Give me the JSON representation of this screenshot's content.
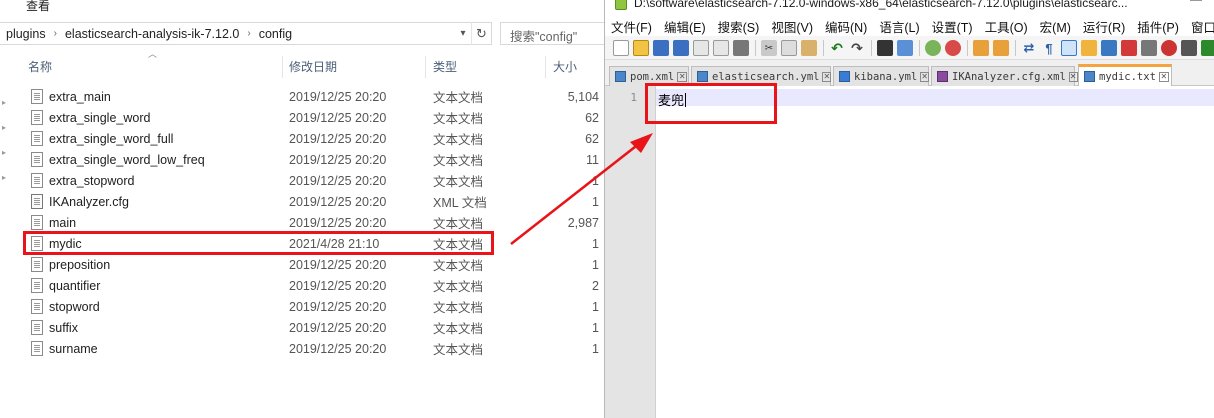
{
  "explorer": {
    "ribbon_tab": "查看",
    "address": {
      "segments": [
        "plugins",
        "elasticsearch-analysis-ik-7.12.0",
        "config"
      ],
      "dropdown_icon": "chevron-down-icon",
      "refresh_icon": "refresh-icon"
    },
    "search": {
      "placeholder": "搜索\"config\""
    },
    "columns": {
      "name": "名称",
      "date": "修改日期",
      "type": "类型",
      "size": "大小"
    },
    "files": [
      {
        "name": "extra_main",
        "date": "2019/12/25 20:20",
        "type": "文本文档",
        "size": "5,104"
      },
      {
        "name": "extra_single_word",
        "date": "2019/12/25 20:20",
        "type": "文本文档",
        "size": "62"
      },
      {
        "name": "extra_single_word_full",
        "date": "2019/12/25 20:20",
        "type": "文本文档",
        "size": "62"
      },
      {
        "name": "extra_single_word_low_freq",
        "date": "2019/12/25 20:20",
        "type": "文本文档",
        "size": "11"
      },
      {
        "name": "extra_stopword",
        "date": "2019/12/25 20:20",
        "type": "文本文档",
        "size": "1"
      },
      {
        "name": "IKAnalyzer.cfg",
        "date": "2019/12/25 20:20",
        "type": "XML 文档",
        "size": "1"
      },
      {
        "name": "main",
        "date": "2019/12/25 20:20",
        "type": "文本文档",
        "size": "2,987"
      },
      {
        "name": "mydic",
        "date": "2021/4/28 21:10",
        "type": "文本文档",
        "size": "1"
      },
      {
        "name": "preposition",
        "date": "2019/12/25 20:20",
        "type": "文本文档",
        "size": "1"
      },
      {
        "name": "quantifier",
        "date": "2019/12/25 20:20",
        "type": "文本文档",
        "size": "2"
      },
      {
        "name": "stopword",
        "date": "2019/12/25 20:20",
        "type": "文本文档",
        "size": "1"
      },
      {
        "name": "suffix",
        "date": "2019/12/25 20:20",
        "type": "文本文档",
        "size": "1"
      },
      {
        "name": "surname",
        "date": "2019/12/25 20:20",
        "type": "文本文档",
        "size": "1"
      }
    ]
  },
  "notepad": {
    "title": "D:\\software\\elasticsearch-7.12.0-windows-x86_64\\elasticsearch-7.12.0\\plugins\\elasticsearc...",
    "minimize_label": "—",
    "menu": [
      "文件(F)",
      "编辑(E)",
      "搜索(S)",
      "视图(V)",
      "编码(N)",
      "语言(L)",
      "设置(T)",
      "工具(O)",
      "宏(M)",
      "运行(R)",
      "插件(P)",
      "窗口"
    ],
    "tabs": [
      {
        "label": "pom.xml",
        "active": false
      },
      {
        "label": "elasticsearch.yml",
        "active": false
      },
      {
        "label": "kibana.yml",
        "active": false
      },
      {
        "label": "IKAnalyzer.cfg.xml",
        "active": false
      },
      {
        "label": "mydic.txt",
        "active": true
      }
    ],
    "tab_close_glyph": "✕",
    "editor": {
      "line_number": "1",
      "content": "麦兜"
    }
  },
  "colors": {
    "highlight_box": "#e8141a",
    "active_tab_accent": "#f4a340",
    "current_line": "#e8e8ff"
  }
}
